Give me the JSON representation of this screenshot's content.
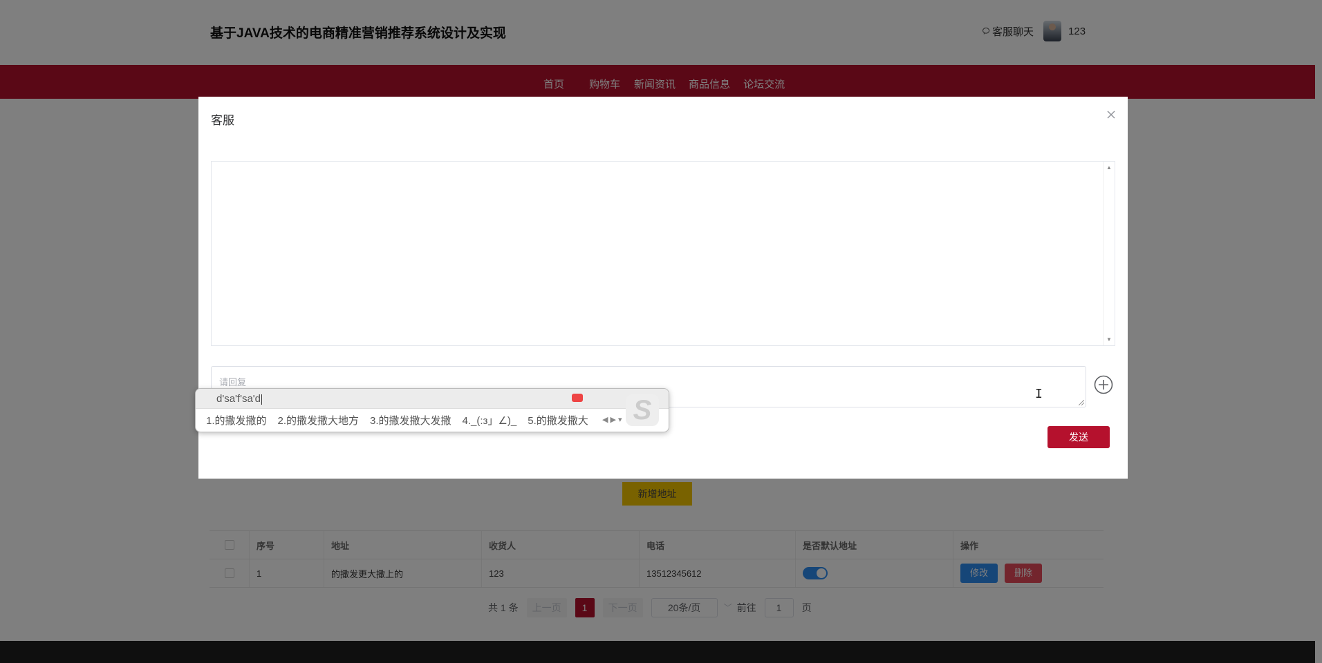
{
  "header": {
    "site_title": "基于JAVA技术的电商精准营销推荐系统设计及实现",
    "chat_link": "客服聊天",
    "username": "123"
  },
  "nav": {
    "items": [
      "首页",
      "购物车",
      "新闻资讯",
      "商品信息",
      "论坛交流"
    ]
  },
  "dialog": {
    "title": "客服",
    "reply_placeholder": "请回复",
    "send_label": "发送"
  },
  "ime": {
    "composition": "d'sa'f'sa'd",
    "candidates": [
      "1.的撒发撒的",
      "2.的撒发撒大地方",
      "3.的撒发撒大发撒",
      "4._(:з」∠)_",
      "5.的撒发撒大"
    ]
  },
  "address": {
    "add_button": "新增地址",
    "columns": [
      "序号",
      "地址",
      "收货人",
      "电话",
      "是否默认地址",
      "操作"
    ],
    "rows": [
      {
        "index": "1",
        "address": "的撒发更大撒上的",
        "receiver": "123",
        "phone": "13512345612",
        "is_default": true
      }
    ],
    "edit_label": "修改",
    "delete_label": "删除"
  },
  "pagination": {
    "total": "共 1 条",
    "prev": "上一页",
    "current": "1",
    "next": "下一页",
    "page_size": "20条/页",
    "goto_label": "前往",
    "goto_value": "1",
    "page_unit": "页"
  },
  "colors": {
    "brand": "#b5112d",
    "accent_yellow": "#f3c400",
    "primary_blue": "#2d8cf0",
    "danger": "#e64a5a"
  }
}
